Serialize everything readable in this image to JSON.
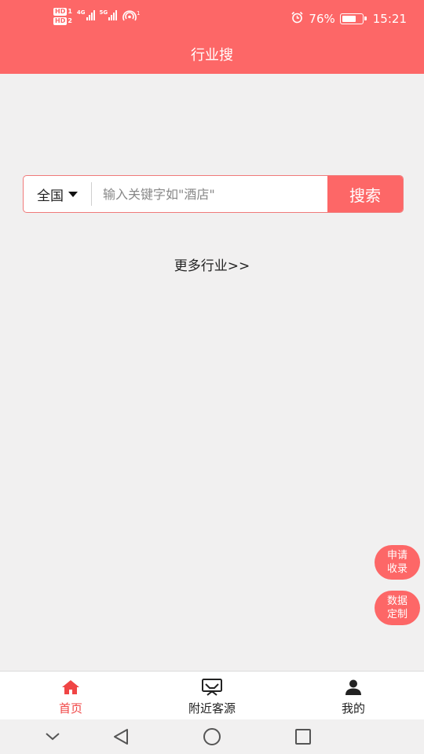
{
  "status_bar": {
    "sim1": "HD",
    "sim1_num": "1",
    "sim2": "HD",
    "sim2_num": "2",
    "net1": "4G",
    "net2": "5G",
    "hotspot_count": "1",
    "battery_text": "76%",
    "battery_level": 0.76,
    "time": "15:21",
    "icons": [
      "alarm-icon",
      "battery-icon",
      "signal-icon",
      "hotspot-icon"
    ]
  },
  "header": {
    "title": "行业搜"
  },
  "search": {
    "region": "全国",
    "placeholder": "输入关键字如\"酒店\"",
    "button_label": "搜索"
  },
  "more_link": "更多行业>>",
  "floating": {
    "apply": [
      "申请",
      "收录"
    ],
    "custom": [
      "数据",
      "定制"
    ]
  },
  "tabs": [
    {
      "label": "首页",
      "icon": "home-icon",
      "active": true
    },
    {
      "label": "附近客源",
      "icon": "inbox-icon",
      "active": false
    },
    {
      "label": "我的",
      "icon": "user-icon",
      "active": false
    }
  ],
  "colors": {
    "brand": "#fd6767",
    "active_tab": "#f04545",
    "background": "#f1f0f0"
  }
}
